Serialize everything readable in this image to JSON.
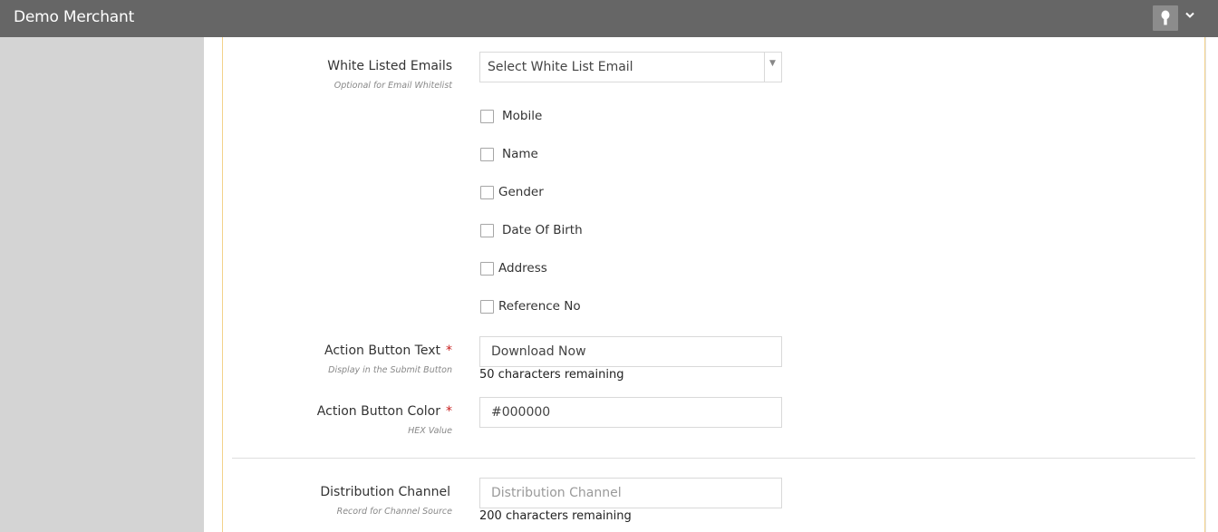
{
  "header": {
    "app_title": "Demo Merchant",
    "avatar_icon": "key-icon",
    "menu_icon": "chevron-down-icon"
  },
  "form": {
    "whitelist": {
      "label": "White Listed Emails",
      "hint": "Optional for Email Whitelist",
      "selected": "Select White List Email"
    },
    "fields": [
      {
        "label": "Mobile",
        "checked": false
      },
      {
        "label": "Name",
        "checked": false
      },
      {
        "label": "Gender",
        "checked": false
      },
      {
        "label": "Date Of Birth",
        "checked": false
      },
      {
        "label": "Address",
        "checked": false
      },
      {
        "label": "Reference No",
        "checked": false
      }
    ],
    "action_text": {
      "label": "Action Button Text",
      "required_mark": "*",
      "hint": "Display in the Submit Button",
      "value": "Download Now",
      "counter": "50 characters remaining"
    },
    "action_color": {
      "label": "Action Button Color",
      "required_mark": "*",
      "hint": "HEX Value",
      "value": "#000000"
    },
    "distribution": {
      "label": "Distribution Channel",
      "hint": "Record for Channel Source",
      "value": "",
      "placeholder": "Distribution Channel",
      "counter": "200 characters remaining"
    }
  },
  "colors": {
    "header_bg": "#666666",
    "sidebar_bg": "#d4d4d4",
    "panel_border": "#f3d28a",
    "required": "#c81e1e"
  }
}
